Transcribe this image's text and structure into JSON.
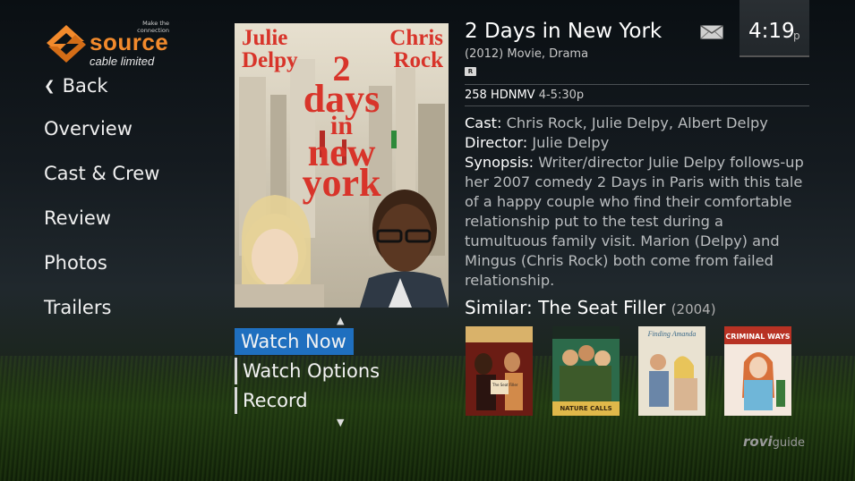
{
  "logo": {
    "tagline_1": "Make the",
    "tagline_2": "connection",
    "word": "source",
    "sub": "cable limited"
  },
  "nav": {
    "back": "Back",
    "items": [
      "Overview",
      "Cast & Crew",
      "Review",
      "Photos",
      "Trailers"
    ]
  },
  "poster": {
    "name_left_1": "Julie",
    "name_left_2": "Delpy",
    "name_right_1": "Chris",
    "name_right_2": "Rock",
    "line_1": "2",
    "line_2": "days",
    "line_3": "in",
    "line_4": "new",
    "line_5": "york"
  },
  "actions": {
    "items": [
      "Watch Now",
      "Watch Options",
      "Record"
    ],
    "selected": 0
  },
  "program": {
    "title": "2 Days in New York",
    "subtitle": "(2012) Movie, Drama",
    "rating": "R",
    "channel": "258 HDNMV",
    "time": "4-5:30p",
    "cast_label": "Cast:",
    "cast": "Chris Rock, Julie Delpy, Albert Delpy",
    "director_label": "Director:",
    "director": "Julie Delpy",
    "synopsis_label": "Synopsis:",
    "synopsis": "Writer/director Julie Delpy follows-up her 2007 comedy 2 Days in Paris with this tale of a happy couple who find their comfortable relationship put to the test during a tumultuous family visit. Marion (Delpy) and Mingus (Chris Rock) both come from failed relationship."
  },
  "clock": {
    "time": "4:19",
    "ampm": "p"
  },
  "similar": {
    "label": "Similar: The Seat Filler",
    "year": "(2004)",
    "thumbs": [
      {
        "caption": "The Seat Filler",
        "color": "#6b1c14"
      },
      {
        "caption": "NATURE CALLS",
        "color": "#2c6a4a"
      },
      {
        "caption": "Finding Amanda",
        "color": "#e9e2d1"
      },
      {
        "caption": "CRIMINAL WAYS",
        "color": "#b83224"
      }
    ]
  },
  "brand": {
    "rovi": "rovi",
    "guide": "guide"
  },
  "colors": {
    "accent": "#1f6fbf",
    "logo_orange": "#f28a2c"
  }
}
